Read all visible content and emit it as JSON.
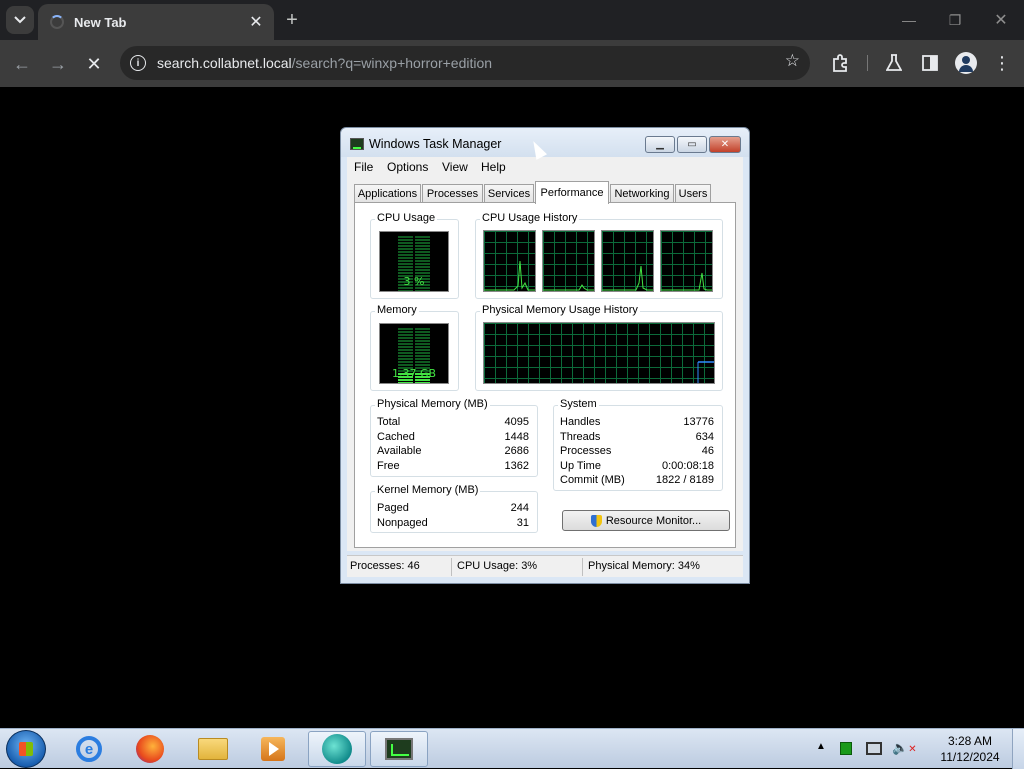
{
  "browser": {
    "tab_title": "New Tab",
    "url_host": "search.collabnet.local",
    "url_path": "/search?q=winxp+horror+edition"
  },
  "task_manager": {
    "title": "Windows Task Manager",
    "menu": [
      "File",
      "Options",
      "View",
      "Help"
    ],
    "tabs": [
      "Applications",
      "Processes",
      "Services",
      "Performance",
      "Networking",
      "Users"
    ],
    "active_tab": "Performance",
    "cpu_usage_label": "CPU Usage",
    "cpu_usage_value": "3 %",
    "cpu_usage_fraction": 0.03,
    "cpu_history_label": "CPU Usage History",
    "memory_label": "Memory",
    "memory_value": "1.37 GB",
    "memory_fraction": 0.34,
    "memory_history_label": "Physical Memory Usage History",
    "physical_memory": {
      "label": "Physical Memory (MB)",
      "rows": [
        {
          "k": "Total",
          "v": "4095"
        },
        {
          "k": "Cached",
          "v": "1448"
        },
        {
          "k": "Available",
          "v": "2686"
        },
        {
          "k": "Free",
          "v": "1362"
        }
      ]
    },
    "kernel_memory": {
      "label": "Kernel Memory (MB)",
      "rows": [
        {
          "k": "Paged",
          "v": "244"
        },
        {
          "k": "Nonpaged",
          "v": "31"
        }
      ]
    },
    "system": {
      "label": "System",
      "rows": [
        {
          "k": "Handles",
          "v": "13776"
        },
        {
          "k": "Threads",
          "v": "634"
        },
        {
          "k": "Processes",
          "v": "46"
        },
        {
          "k": "Up Time",
          "v": "0:00:08:18"
        },
        {
          "k": "Commit (MB)",
          "v": "1822 / 8189"
        }
      ]
    },
    "resource_monitor_button": "Resource Monitor...",
    "status": {
      "processes": "Processes: 46",
      "cpu": "CPU Usage: 3%",
      "memory": "Physical Memory: 34%"
    }
  },
  "taskbar": {
    "time": "3:28 AM",
    "date": "11/12/2024"
  },
  "colors": {
    "graph_line": "#43e343",
    "memory_line": "#2f8cff",
    "grid": "#0c6a3a"
  }
}
